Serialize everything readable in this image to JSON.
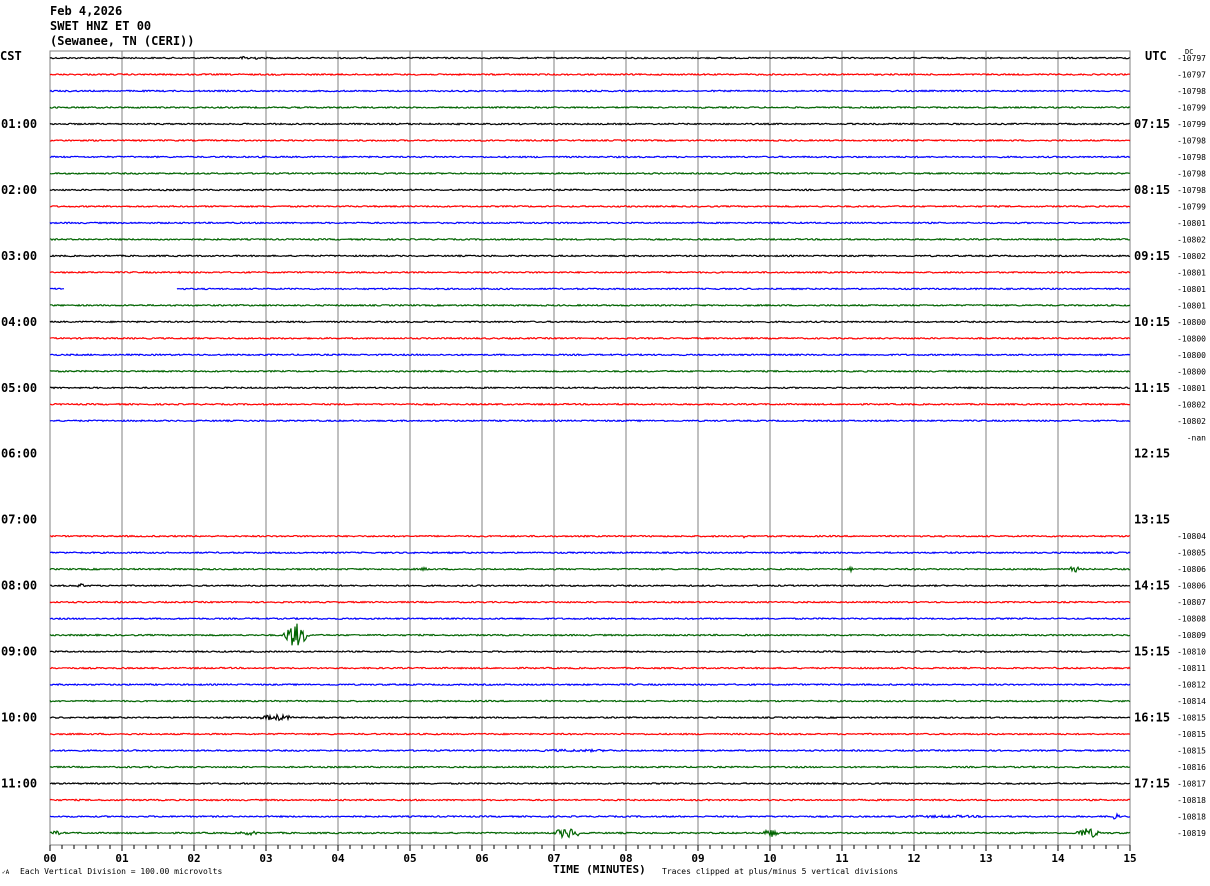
{
  "header": {
    "date": "Feb 4,2026",
    "station": "SWET HNZ ET 00",
    "location": "(Sewanee, TN (CERI))"
  },
  "left_timezone": "CST",
  "right_timezone": "UTC",
  "dc_label": "DC",
  "footer": {
    "scale_note": "Each Vertical Division =  100.00 microvolts",
    "xlabel": "TIME (MINUTES)",
    "clip_note": "Traces clipped at plus/minus 5 vertical divisions",
    "corner_mark": "✓A"
  },
  "chart_data": {
    "type": "line",
    "title": "Feb 4,2026 SWET HNZ ET 00 (Sewanee, TN (CERI))",
    "xlabel": "TIME (MINUTES)",
    "xlim": [
      0,
      15
    ],
    "x_ticks": [
      "00",
      "01",
      "02",
      "03",
      "04",
      "05",
      "06",
      "07",
      "08",
      "09",
      "10",
      "11",
      "12",
      "13",
      "14",
      "15"
    ],
    "grid": true,
    "trace_colors": [
      "#000000",
      "#ff0000",
      "#0000ff",
      "#006400"
    ],
    "left_hour_labels": [
      "",
      "01:00",
      "02:00",
      "03:00",
      "04:00",
      "05:00",
      "06:00",
      "07:00",
      "08:00",
      "09:00",
      "10:00",
      "11:00"
    ],
    "right_hour_labels": [
      "",
      "07:15",
      "08:15",
      "09:15",
      "10:15",
      "11:15",
      "12:15",
      "13:15",
      "14:15",
      "15:15",
      "16:15",
      "17:15"
    ],
    "rows_per_hour": 4,
    "dc_offsets": [
      "-10797",
      "-10797",
      "-10798",
      "-10799",
      "-10799",
      "-10798",
      "-10798",
      "-10798",
      "-10798",
      "-10799",
      "-10801",
      "-10802",
      "-10802",
      "-10801",
      "-10801",
      "-10801",
      "-10800",
      "-10800",
      "-10800",
      "-10800",
      "-10801",
      "-10802",
      "-10802",
      "-nan",
      "",
      "",
      "",
      "",
      "",
      "-10804",
      "-10805",
      "-10806",
      "-10806",
      "-10807",
      "-10808",
      "-10809",
      "-10810",
      "-10811",
      "-10812",
      "-10814",
      "-10815",
      "-10815",
      "-10815",
      "-10816",
      "-10817",
      "-10818",
      "-10818",
      "-10819"
    ],
    "missing_rows": [
      23,
      24,
      25,
      26,
      27,
      28
    ],
    "data_gaps": [
      {
        "row": 14,
        "from_min": 0.2,
        "to_min": 1.75
      }
    ],
    "events": [
      {
        "row": 0,
        "min": 2.6,
        "amp": 2,
        "dur": 0.6
      },
      {
        "row": 5,
        "min": 11.9,
        "amp": 1.5,
        "dur": 0.1
      },
      {
        "row": 13,
        "min": 1.75,
        "amp": 1,
        "dur": 0.2
      },
      {
        "row": 29,
        "min": 9.6,
        "amp": 1.5,
        "dur": 0.15
      },
      {
        "row": 31,
        "min": 5.1,
        "amp": 1.5,
        "dur": 0.4
      },
      {
        "row": 31,
        "min": 11.1,
        "amp": 3,
        "dur": 0.1
      },
      {
        "row": 31,
        "min": 14.15,
        "amp": 3,
        "dur": 0.3
      },
      {
        "row": 32,
        "min": 0.35,
        "amp": 2,
        "dur": 0.3
      },
      {
        "row": 35,
        "min": 3.25,
        "amp": 12,
        "dur": 0.6
      },
      {
        "row": 40,
        "min": 2.9,
        "amp": 3,
        "dur": 0.9
      },
      {
        "row": 42,
        "min": 6.5,
        "amp": 1.2,
        "dur": 3
      },
      {
        "row": 46,
        "min": 11.5,
        "amp": 1.2,
        "dur": 3.5
      },
      {
        "row": 46,
        "min": 14.7,
        "amp": 3,
        "dur": 0.3
      },
      {
        "row": 47,
        "min": 0.0,
        "amp": 2,
        "dur": 0.3
      },
      {
        "row": 47,
        "min": 2.6,
        "amp": 2,
        "dur": 0.6
      },
      {
        "row": 47,
        "min": 7.0,
        "amp": 5,
        "dur": 0.7
      },
      {
        "row": 47,
        "min": 9.9,
        "amp": 4,
        "dur": 0.4
      },
      {
        "row": 47,
        "min": 14.25,
        "amp": 5,
        "dur": 0.6
      }
    ]
  }
}
